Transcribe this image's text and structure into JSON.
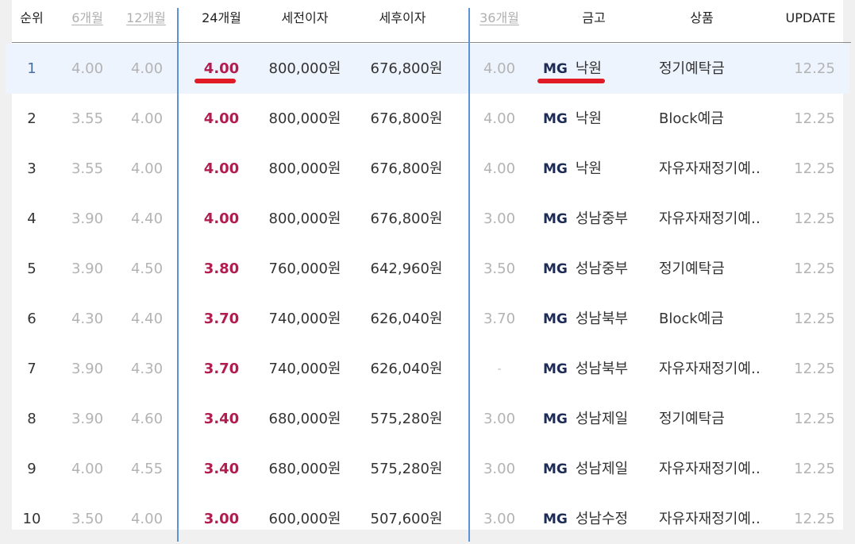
{
  "headers": {
    "rank": "순위",
    "m6": "6개월",
    "m12": "12개월",
    "m24": "24개월",
    "pretax": "세전이자",
    "aftertax": "세후이자",
    "m36": "36개월",
    "bank": "금고",
    "product": "상품",
    "update": "UPDATE"
  },
  "colors": {
    "accent_rate": "#b11d4e",
    "divider_blue": "#5b92d8",
    "highlight_row": "#eef4fd",
    "red_underline": "#e01b25"
  },
  "rows": [
    {
      "rank": "1",
      "m6": "4.00",
      "m12": "4.00",
      "m24": "4.00",
      "pretax": "800,000원",
      "aftertax": "676,800원",
      "m36": "4.00",
      "brand": "MG",
      "bank": "낙원",
      "product": "정기예탁금",
      "update": "12.25"
    },
    {
      "rank": "2",
      "m6": "3.55",
      "m12": "4.00",
      "m24": "4.00",
      "pretax": "800,000원",
      "aftertax": "676,800원",
      "m36": "4.00",
      "brand": "MG",
      "bank": "낙원",
      "product": "Block예금",
      "update": "12.25"
    },
    {
      "rank": "3",
      "m6": "3.55",
      "m12": "4.00",
      "m24": "4.00",
      "pretax": "800,000원",
      "aftertax": "676,800원",
      "m36": "4.00",
      "brand": "MG",
      "bank": "낙원",
      "product": "자유자재정기예…",
      "update": "12.25"
    },
    {
      "rank": "4",
      "m6": "3.90",
      "m12": "4.40",
      "m24": "4.00",
      "pretax": "800,000원",
      "aftertax": "676,800원",
      "m36": "3.00",
      "brand": "MG",
      "bank": "성남중부",
      "product": "자유자재정기예…",
      "update": "12.25"
    },
    {
      "rank": "5",
      "m6": "3.90",
      "m12": "4.50",
      "m24": "3.80",
      "pretax": "760,000원",
      "aftertax": "642,960원",
      "m36": "3.50",
      "brand": "MG",
      "bank": "성남중부",
      "product": "정기예탁금",
      "update": "12.25"
    },
    {
      "rank": "6",
      "m6": "4.30",
      "m12": "4.40",
      "m24": "3.70",
      "pretax": "740,000원",
      "aftertax": "626,040원",
      "m36": "3.70",
      "brand": "MG",
      "bank": "성남북부",
      "product": "Block예금",
      "update": "12.25"
    },
    {
      "rank": "7",
      "m6": "3.90",
      "m12": "4.30",
      "m24": "3.70",
      "pretax": "740,000원",
      "aftertax": "626,040원",
      "m36": "-",
      "brand": "MG",
      "bank": "성남북부",
      "product": "자유자재정기예…",
      "update": "12.25"
    },
    {
      "rank": "8",
      "m6": "3.90",
      "m12": "4.60",
      "m24": "3.40",
      "pretax": "680,000원",
      "aftertax": "575,280원",
      "m36": "3.00",
      "brand": "MG",
      "bank": "성남제일",
      "product": "정기예탁금",
      "update": "12.25"
    },
    {
      "rank": "9",
      "m6": "4.00",
      "m12": "4.55",
      "m24": "3.40",
      "pretax": "680,000원",
      "aftertax": "575,280원",
      "m36": "3.00",
      "brand": "MG",
      "bank": "성남제일",
      "product": "자유자재정기예…",
      "update": "12.25"
    },
    {
      "rank": "10",
      "m6": "3.50",
      "m12": "4.00",
      "m24": "3.00",
      "pretax": "600,000원",
      "aftertax": "507,600원",
      "m36": "3.00",
      "brand": "MG",
      "bank": "성남수정",
      "product": "자유자재정기예…",
      "update": "12.25"
    }
  ]
}
